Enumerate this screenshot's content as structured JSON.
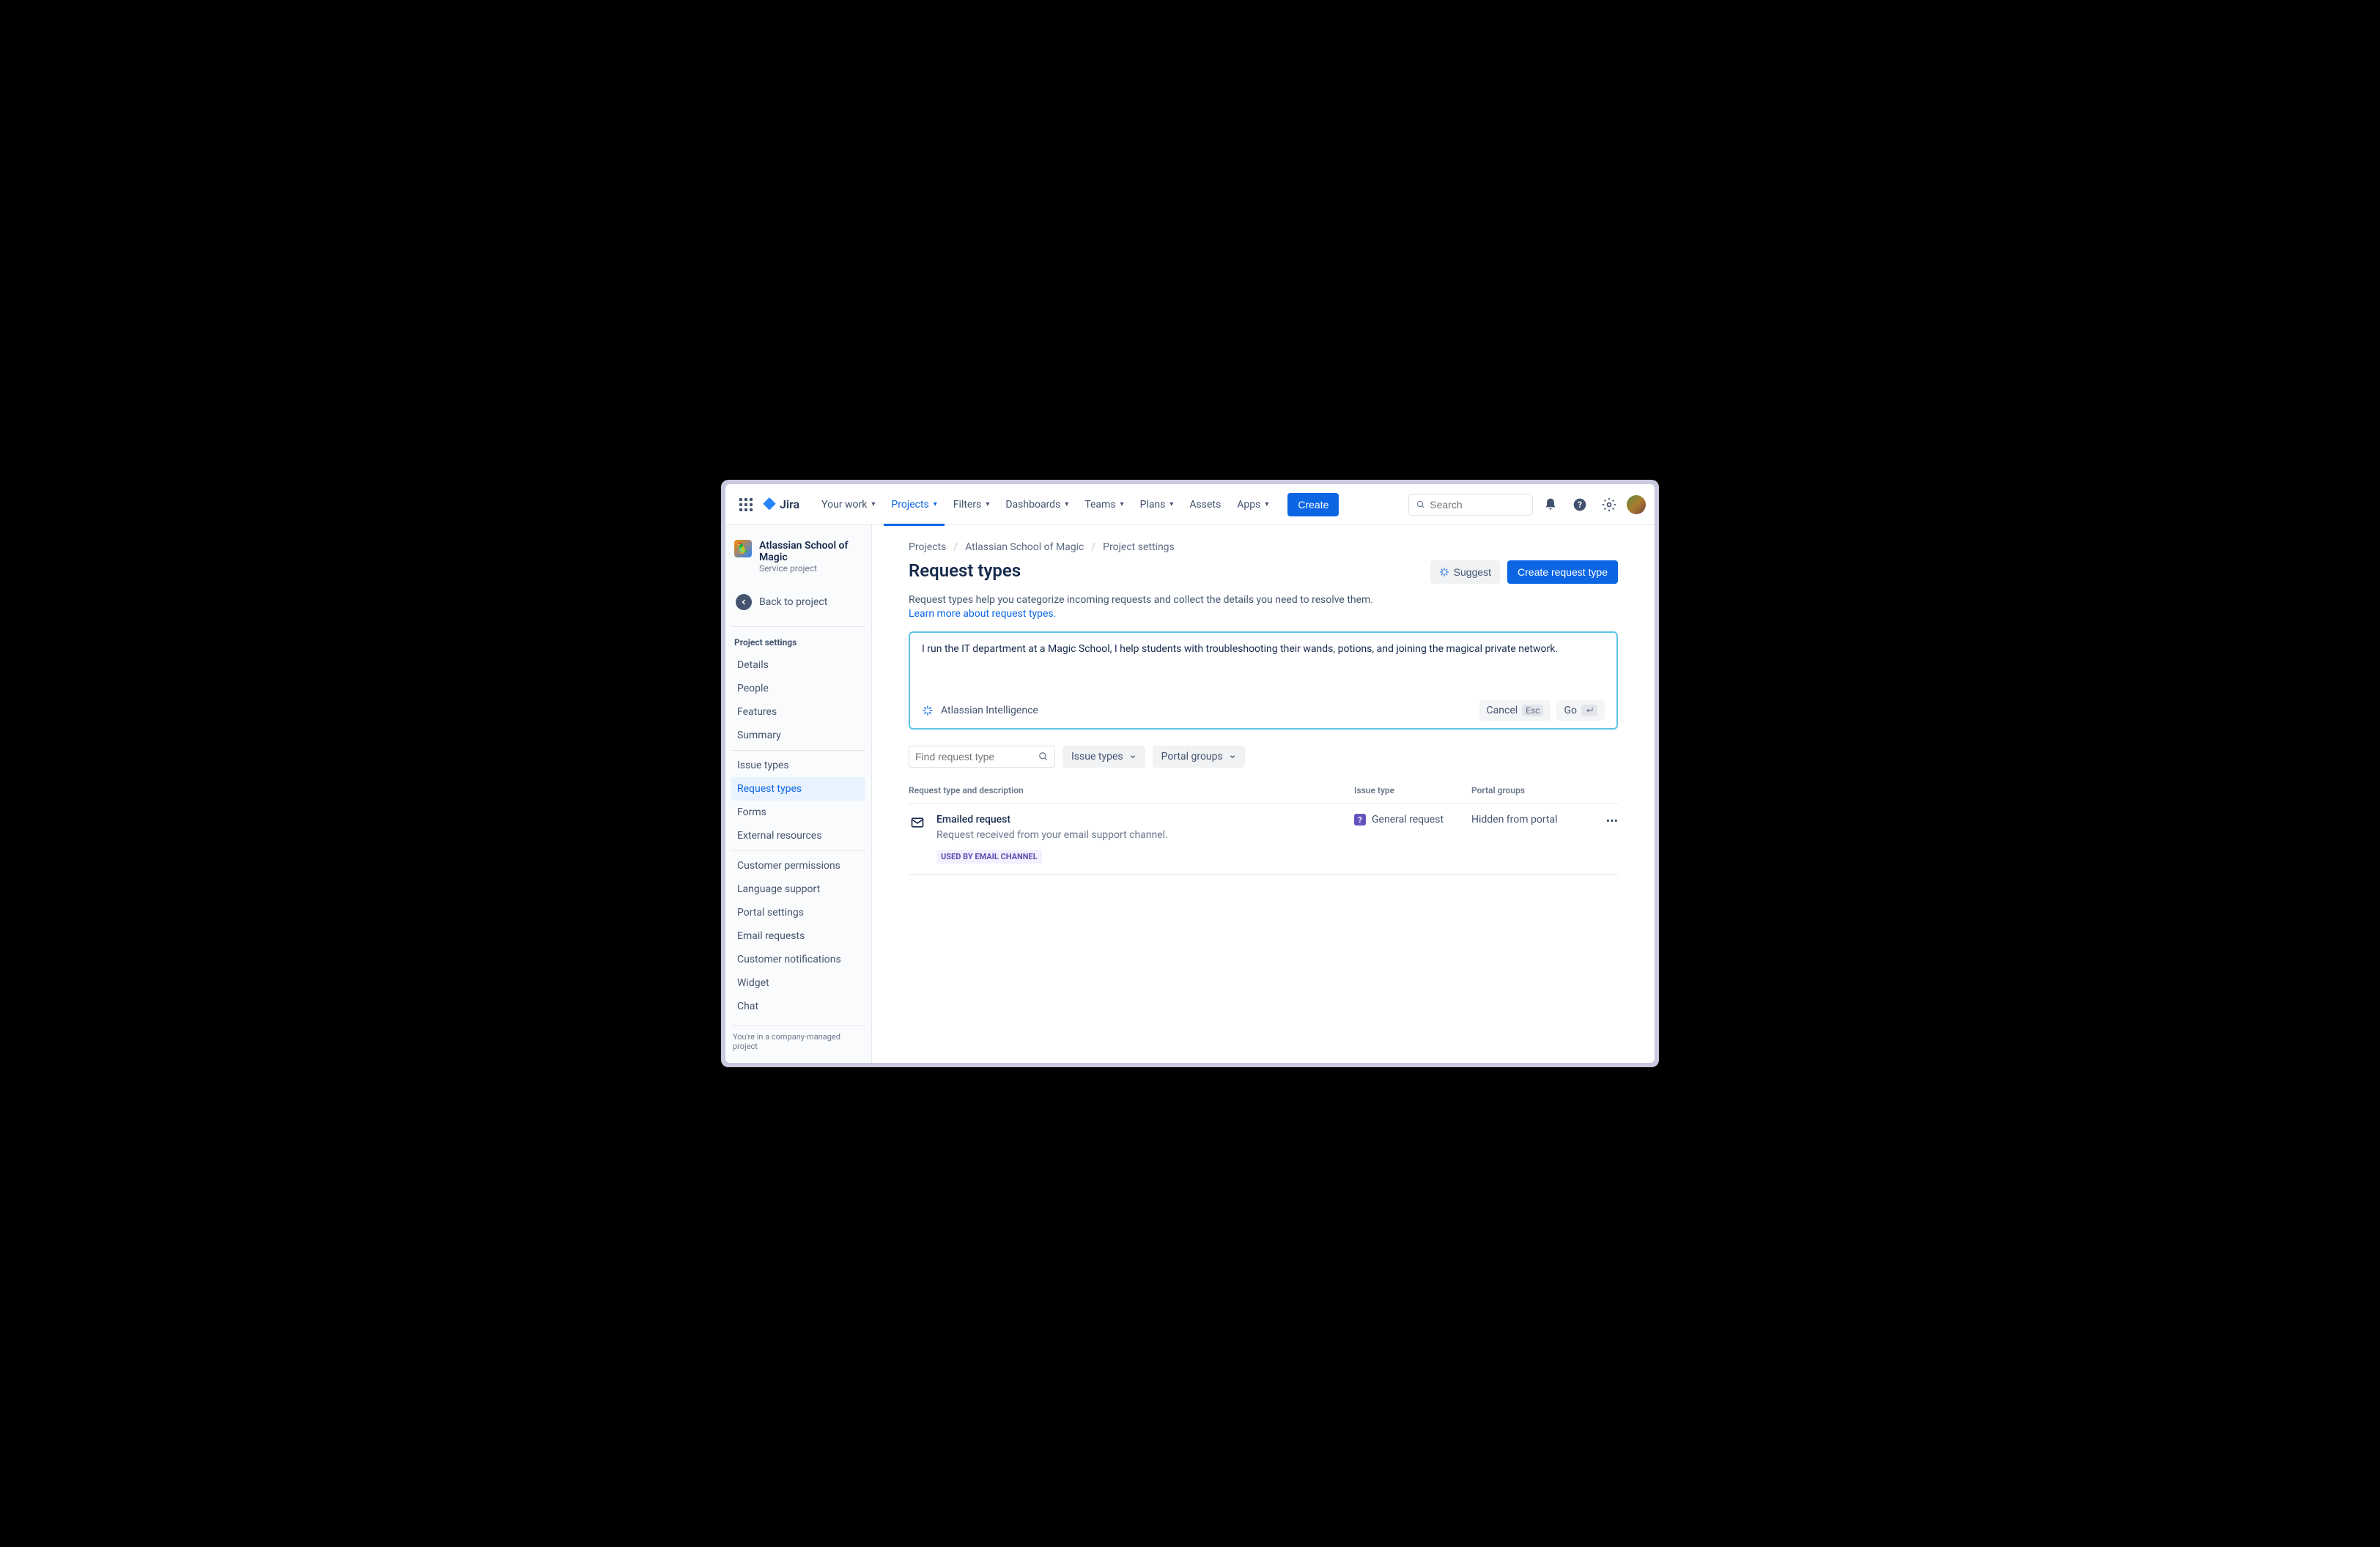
{
  "topbar": {
    "logo_text": "Jira",
    "nav": [
      {
        "label": "Your work",
        "has_chevron": true
      },
      {
        "label": "Projects",
        "has_chevron": true,
        "active": true
      },
      {
        "label": "Filters",
        "has_chevron": true
      },
      {
        "label": "Dashboards",
        "has_chevron": true
      },
      {
        "label": "Teams",
        "has_chevron": true
      },
      {
        "label": "Plans",
        "has_chevron": true
      },
      {
        "label": "Assets",
        "has_chevron": false
      },
      {
        "label": "Apps",
        "has_chevron": true
      }
    ],
    "create_label": "Create",
    "search_placeholder": "Search"
  },
  "sidebar": {
    "project_title": "Atlassian School of Magic",
    "project_subtitle": "Service project",
    "back_label": "Back to project",
    "section_title": "Project settings",
    "group1": [
      "Details",
      "People",
      "Features",
      "Summary"
    ],
    "group2": [
      "Issue types",
      "Request types",
      "Forms",
      "External resources"
    ],
    "group3": [
      "Customer permissions",
      "Language support",
      "Portal settings",
      "Email requests",
      "Customer notifications",
      "Widget",
      "Chat"
    ],
    "active_item": "Request types",
    "footer": "You're in a company-managed project"
  },
  "breadcrumb": [
    "Projects",
    "Atlassian School of Magic",
    "Project settings"
  ],
  "page": {
    "title": "Request types",
    "suggest_label": "Suggest",
    "create_label": "Create request type",
    "intro": "Request types help you categorize incoming requests and collect the details you need to resolve them.",
    "learn_more": "Learn more about request types."
  },
  "ai_box": {
    "input_text": "I run the IT department at a Magic School, I help students with troubleshooting their wands, potions, and joining the magical private network.",
    "brand": "Atlassian Intelligence",
    "cancel_label": "Cancel",
    "cancel_kbd": "Esc",
    "go_label": "Go"
  },
  "filters": {
    "search_placeholder": "Find request type",
    "dropdown1": "Issue types",
    "dropdown2": "Portal groups"
  },
  "table": {
    "headers": {
      "name": "Request type and description",
      "issue": "Issue type",
      "portal": "Portal groups"
    },
    "rows": [
      {
        "name": "Emailed request",
        "description": "Request received from your email support channel.",
        "badge": "USED BY EMAIL CHANNEL",
        "issue_type": "General request",
        "portal_groups": "Hidden from portal"
      }
    ]
  }
}
